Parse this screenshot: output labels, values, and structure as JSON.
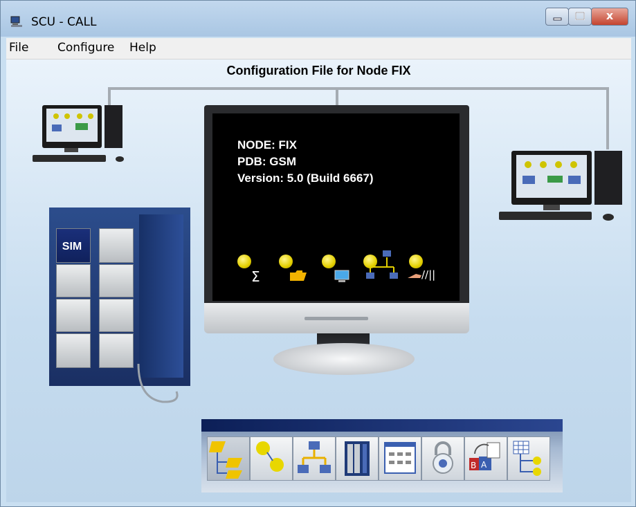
{
  "window": {
    "title": "SCU - CALL",
    "minimize_label": "",
    "maximize_label": "",
    "close_label": "x"
  },
  "menubar": {
    "items": [
      {
        "label": "File"
      },
      {
        "label": "Configure"
      },
      {
        "label": "Help"
      }
    ]
  },
  "main": {
    "heading": "Configuration File for Node FIX",
    "monitor": {
      "node": "NODE: FIX",
      "pdb": "PDB: GSM",
      "version": "Version:  5.0 (Build 6667)"
    },
    "rack": {
      "sim_label": "SIM"
    },
    "monitor_icons": [
      {
        "name": "statistics-icon",
        "glyph": "Σ"
      },
      {
        "name": "folder-icon",
        "glyph": ""
      },
      {
        "name": "terminal-icon",
        "glyph": ""
      },
      {
        "name": "network-icon",
        "glyph": ""
      },
      {
        "name": "handshake-icon",
        "glyph": "//||"
      }
    ],
    "toolbar_buttons": [
      {
        "name": "node-tree-button"
      },
      {
        "name": "call-button"
      },
      {
        "name": "network-button"
      },
      {
        "name": "hardware-rack-button"
      },
      {
        "name": "form-list-button"
      },
      {
        "name": "security-lock-button"
      },
      {
        "name": "language-convert-button"
      },
      {
        "name": "table-tree-button"
      }
    ]
  },
  "colors": {
    "background": "#c9dff1",
    "monitor": "#000000",
    "rack": "#1f3a78",
    "yellow": "#e8d700"
  }
}
